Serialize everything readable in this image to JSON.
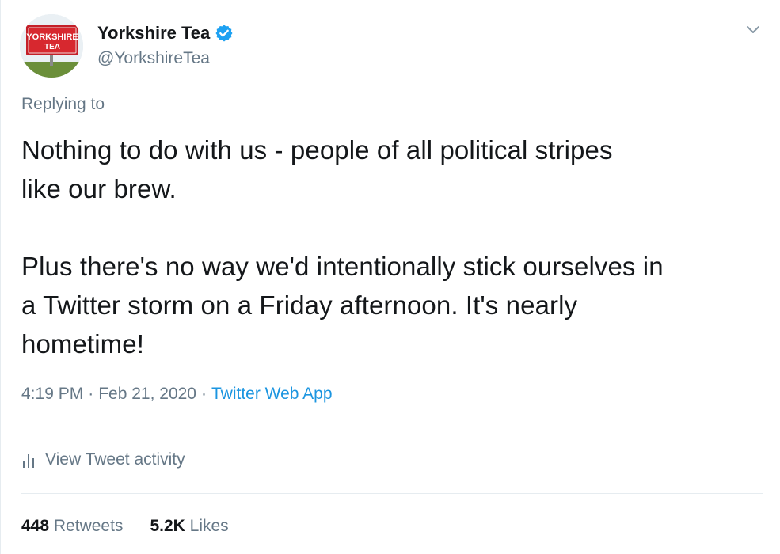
{
  "author": {
    "display_name": "Yorkshire Tea",
    "handle": "@YorkshireTea",
    "verified": true,
    "avatar_text_line1": "YORKSHIRE",
    "avatar_text_line2": "TEA"
  },
  "replying_to_label": "Replying to",
  "tweet_text": "Nothing to do with us - people of all political stripes\nlike our brew.\n\nPlus there's no way we'd intentionally stick ourselves in\na Twitter storm on a Friday afternoon. It's nearly\nhometime!",
  "meta": {
    "time": "4:19 PM",
    "separator": "·",
    "date": "Feb 21, 2020",
    "source": "Twitter Web App"
  },
  "activity_label": "View Tweet activity",
  "stats": {
    "retweets_count": "448",
    "retweets_label": "Retweets",
    "likes_count": "5.2K",
    "likes_label": "Likes"
  },
  "colors": {
    "text_primary": "#14171a",
    "text_secondary": "#657786",
    "link_blue": "#1b95e0",
    "verified_blue": "#1da1f2",
    "divider": "#e6ecf0",
    "brand_red": "#d7282f"
  },
  "icons": {
    "verified": "verified-badge-icon",
    "caret": "chevron-down-icon",
    "activity": "bar-chart-icon"
  }
}
